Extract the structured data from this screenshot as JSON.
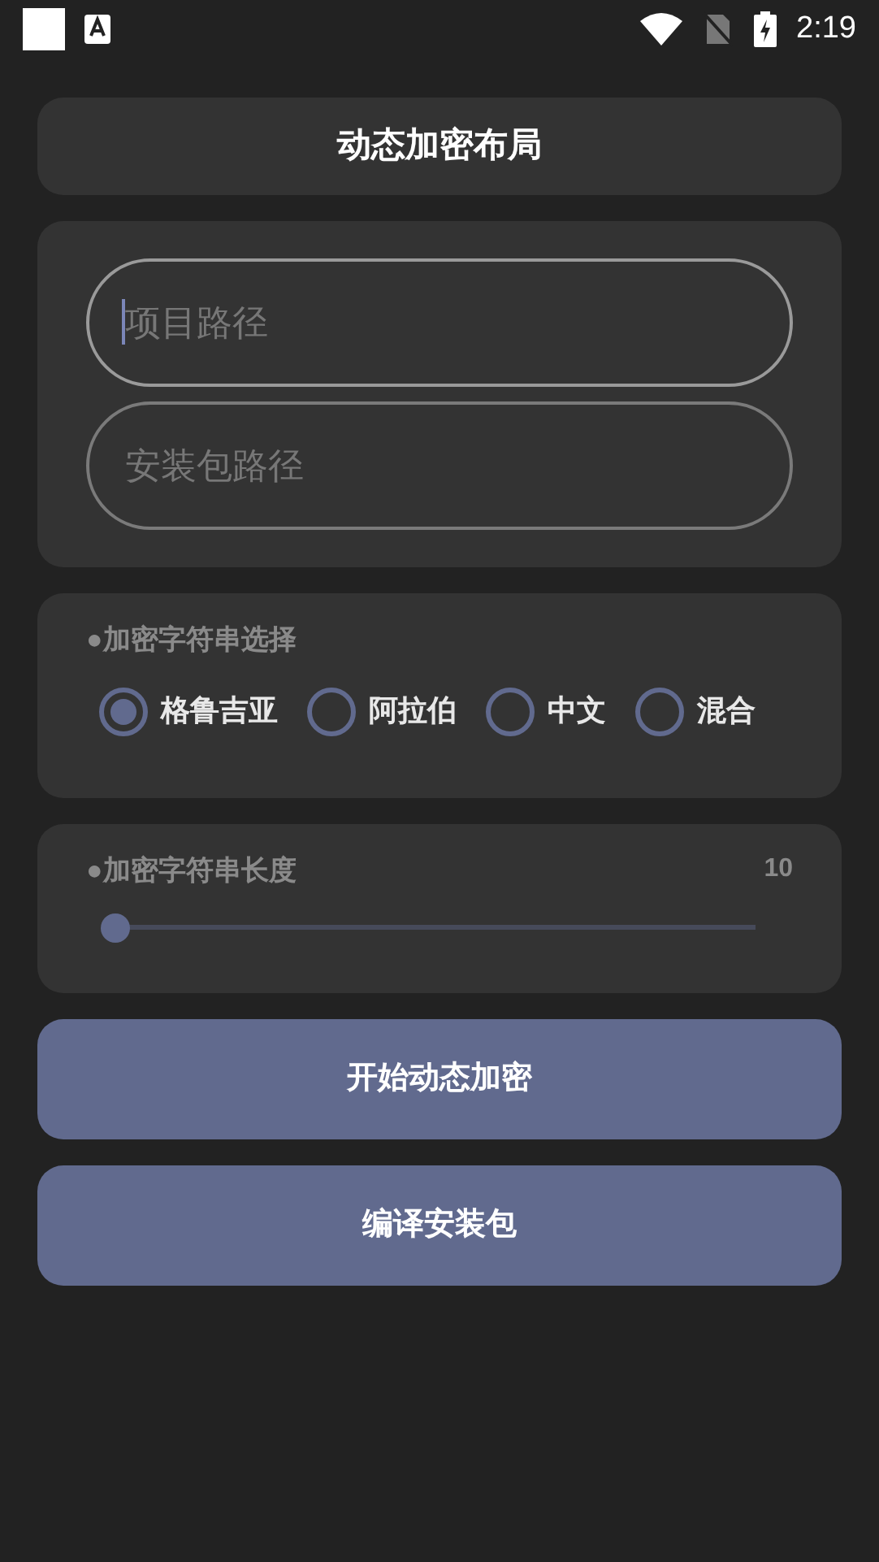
{
  "status_bar": {
    "time": "2:19"
  },
  "title": "动态加密布局",
  "fields": [
    {
      "placeholder": "项目路径",
      "focused": true
    },
    {
      "placeholder": "安装包路径",
      "focused": false
    }
  ],
  "string_choice": {
    "label": "●加密字符串选择",
    "options": [
      {
        "label": "格鲁吉亚",
        "selected": true
      },
      {
        "label": "阿拉伯",
        "selected": false
      },
      {
        "label": "中文",
        "selected": false
      },
      {
        "label": "混合",
        "selected": false
      }
    ]
  },
  "string_length": {
    "label": "●加密字符串长度",
    "reading": "10",
    "level": 0
  },
  "buttons": [
    "开始动态加密",
    "编译安装包"
  ]
}
